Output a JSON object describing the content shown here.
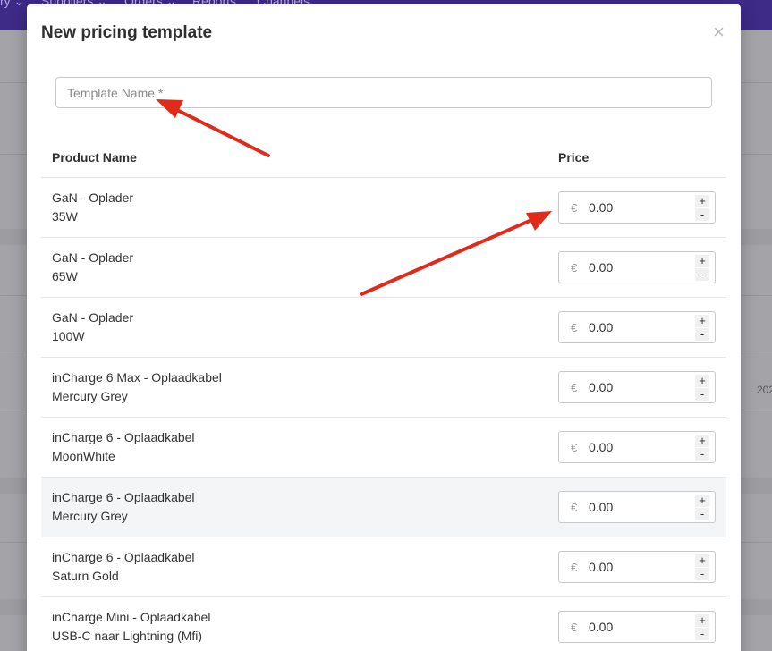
{
  "background": {
    "nav_items": [
      "ry ⌄",
      "Suppliers ⌄",
      "Orders ⌄",
      "Reports",
      "Channels"
    ],
    "partial_date": "202"
  },
  "modal": {
    "title": "New pricing template",
    "close_symbol": "×",
    "template_name": {
      "value": "",
      "placeholder": "Template Name *"
    },
    "columns": {
      "product": "Product Name",
      "price": "Price"
    },
    "currency_symbol": "€",
    "stepper": {
      "plus": "+",
      "minus": "-"
    },
    "rows": [
      {
        "name": "GaN - Oplader",
        "variant": "35W",
        "price": "0.00",
        "shaded": false
      },
      {
        "name": "GaN - Oplader",
        "variant": "65W",
        "price": "0.00",
        "shaded": false
      },
      {
        "name": "GaN - Oplader",
        "variant": "100W",
        "price": "0.00",
        "shaded": false
      },
      {
        "name": "inCharge 6 Max - Oplaadkabel",
        "variant": "Mercury Grey",
        "price": "0.00",
        "shaded": false
      },
      {
        "name": "inCharge 6 - Oplaadkabel",
        "variant": "MoonWhite",
        "price": "0.00",
        "shaded": false
      },
      {
        "name": "inCharge 6 - Oplaadkabel",
        "variant": "Mercury Grey",
        "price": "0.00",
        "shaded": true
      },
      {
        "name": "inCharge 6 - Oplaadkabel",
        "variant": "Saturn Gold",
        "price": "0.00",
        "shaded": false
      },
      {
        "name": "inCharge Mini - Oplaadkabel",
        "variant": "USB-C naar Lightning (Mfi)",
        "price": "0.00",
        "shaded": false
      }
    ]
  },
  "annotation_color": "#e02b1a"
}
